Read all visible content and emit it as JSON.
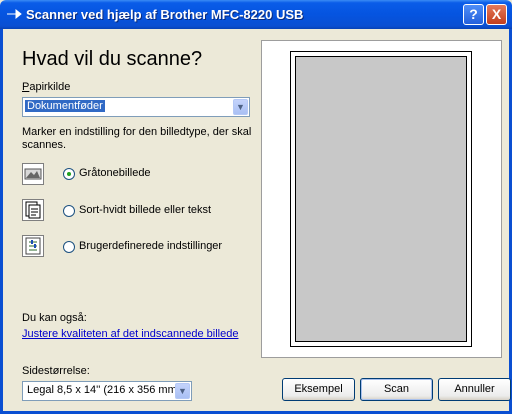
{
  "window": {
    "title": "Scanner ved hjælp af Brother MFC-8220 USB",
    "help": "?",
    "close": "X"
  },
  "heading": "Hvad vil du scanne?",
  "paper_source": {
    "label": "Papirkilde",
    "value": "Dokumentføder"
  },
  "instruction": [
    "Marker en indstilling for den billedtype, der skal",
    "scannes."
  ],
  "options": [
    {
      "label": "Gråtonebillede",
      "icon": "grayscale-image-icon",
      "selected": true
    },
    {
      "label": "Sort-hvidt billede eller tekst",
      "icon": "bw-text-icon",
      "selected": false
    },
    {
      "label": "Brugerdefinerede indstillinger",
      "icon": "custom-settings-icon",
      "selected": false
    }
  ],
  "also": {
    "label": "Du kan også:",
    "link": "Justere kvaliteten af det indscannede billede"
  },
  "page_size": {
    "label": "Sidestørrelse:",
    "value": "Legal 8,5 x 14'' (216 x 356 mm)"
  },
  "buttons": {
    "preview": "Eksempel",
    "scan": "Scan",
    "cancel": "Annuller"
  },
  "colors": {
    "titlebar": "#0a4fd2",
    "window_bg": "#ece9d8",
    "link": "#0000cc",
    "preview_page": "#c8c8c8"
  }
}
